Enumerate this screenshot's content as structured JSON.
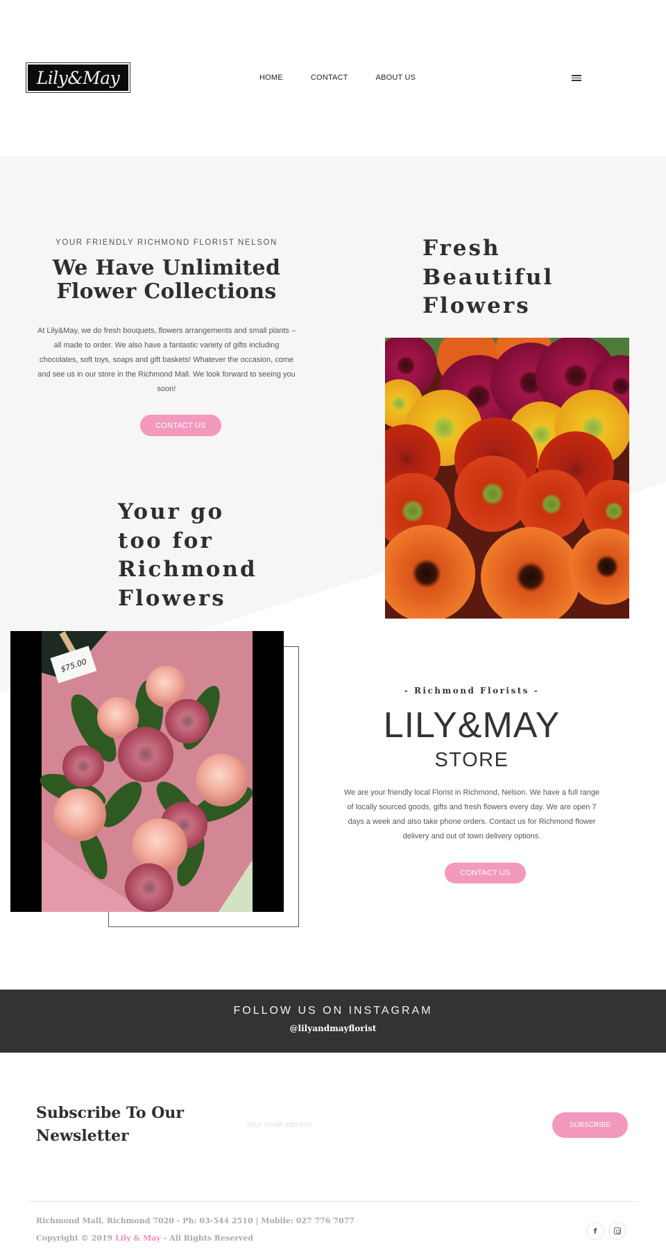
{
  "header": {
    "logo_text": "Lily&May",
    "nav": [
      {
        "label": "HOME"
      },
      {
        "label": "CONTACT"
      },
      {
        "label": "ABOUT US"
      }
    ],
    "menu_icon": "hamburger-icon"
  },
  "hero": {
    "eyebrow": "YOUR FRIENDLY RICHMOND FLORIST NELSON",
    "title_line1": "We Have Unlimited",
    "title_line2": "Flower Collections",
    "body": "At Lily&May, we do fresh bouquets, flowers arrangements and small plants – all made to order. We also have a fantastic variety of gifts including chocolates, soft toys, soaps and gift baskets! Whatever the occasion, come and see us in our store in the Richmond Mall. We look forward to seeing you soon!",
    "cta_label": "CONTACT US"
  },
  "feature_right": {
    "title_lines": [
      "Fresh",
      "Beautiful",
      "Flowers"
    ],
    "image_alt": "Colorful gerbera daisies"
  },
  "feature_left": {
    "title_lines": [
      "Your go",
      "too for",
      "Richmond",
      "Flowers"
    ],
    "image_alt": "Bouquet of roses and proteas",
    "price_tag": "$75.00"
  },
  "store": {
    "eyebrow": "- Richmond Florists -",
    "name": "LILY&MAY",
    "subtitle": "STORE",
    "body": "We are your friendly local Florist in Richmond, Nelson. We have a full range of locally sourced goods, gifts and fresh flowers every day. We are open 7 days a week and also take phone orders. Contact us for Richmond flower delivery and out of town delivery options.",
    "cta_label": "CONTACT US"
  },
  "instagram": {
    "title": "FOLLOW US ON INSTAGRAM",
    "handle": "@lilyandmayflorist"
  },
  "newsletter": {
    "title_line1": "Subscribe To Our",
    "title_line2": "Newsletter",
    "email_placeholder": "Your email address",
    "email_value": "",
    "submit_label": "SUBSCRIBE"
  },
  "footer": {
    "address": "Richmond Mall, Richmond 7020  - Ph: 03-544 2510 | Mobile: 027 776 7077",
    "copyright_prefix": "Copyright © 2019 ",
    "brand": "Lily & May",
    "copyright_suffix": " - All Rights Reserved",
    "social": [
      {
        "name": "facebook",
        "glyph": "f"
      },
      {
        "name": "instagram",
        "glyph": ""
      }
    ]
  },
  "colors": {
    "accent_pink": "#f299bd",
    "dark_band": "#333333",
    "light_gray_bg": "#f6f6f6",
    "text_dark": "#2e2e2e"
  }
}
